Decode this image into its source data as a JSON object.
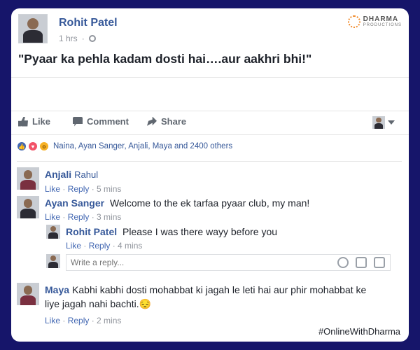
{
  "post": {
    "author": "Rohit Patel",
    "time": "1 hrs",
    "text": "\"Pyaar ka pehla kadam dosti hai….aur aakhri bhi!\"",
    "brand_name": "DHARMA",
    "brand_sub": "PRODUCTIONS"
  },
  "actions": {
    "like": "Like",
    "comment": "Comment",
    "share": "Share"
  },
  "reactions": {
    "summary": "Naina, Ayan Sanger, Anjali, Maya and 2400 others",
    "icons": [
      "like-reaction",
      "love-reaction",
      "wow-reaction"
    ]
  },
  "comments": [
    {
      "name": "Anjali",
      "tag": "Rahul",
      "text": "",
      "like": "Like",
      "reply": "Reply",
      "time": "5 mins"
    },
    {
      "name": "Ayan Sanger",
      "tag": "",
      "text": "Welcome to the ek tarfaa pyaar club, my man!",
      "like": "Like",
      "reply": "Reply",
      "time": "3 mins"
    },
    {
      "name": "Rohit Patel",
      "tag": "",
      "text": "Please I was there wayy before you",
      "like": "Like",
      "reply": "Reply",
      "time": "4 mins"
    },
    {
      "name": "Maya",
      "tag": "",
      "text": "Kabhi kabhi dosti mohabbat ki jagah le leti hai aur phir mohabbat ke liye jagah nahi bachti.😔",
      "like": "Like",
      "reply": "Reply",
      "time": "2 mins"
    }
  ],
  "reply_box": {
    "placeholder": "Write a reply..."
  },
  "hashtag": "#OnlineWithDharma",
  "colors": {
    "background": "#16156a",
    "link": "#365899",
    "muted": "#90949c"
  }
}
